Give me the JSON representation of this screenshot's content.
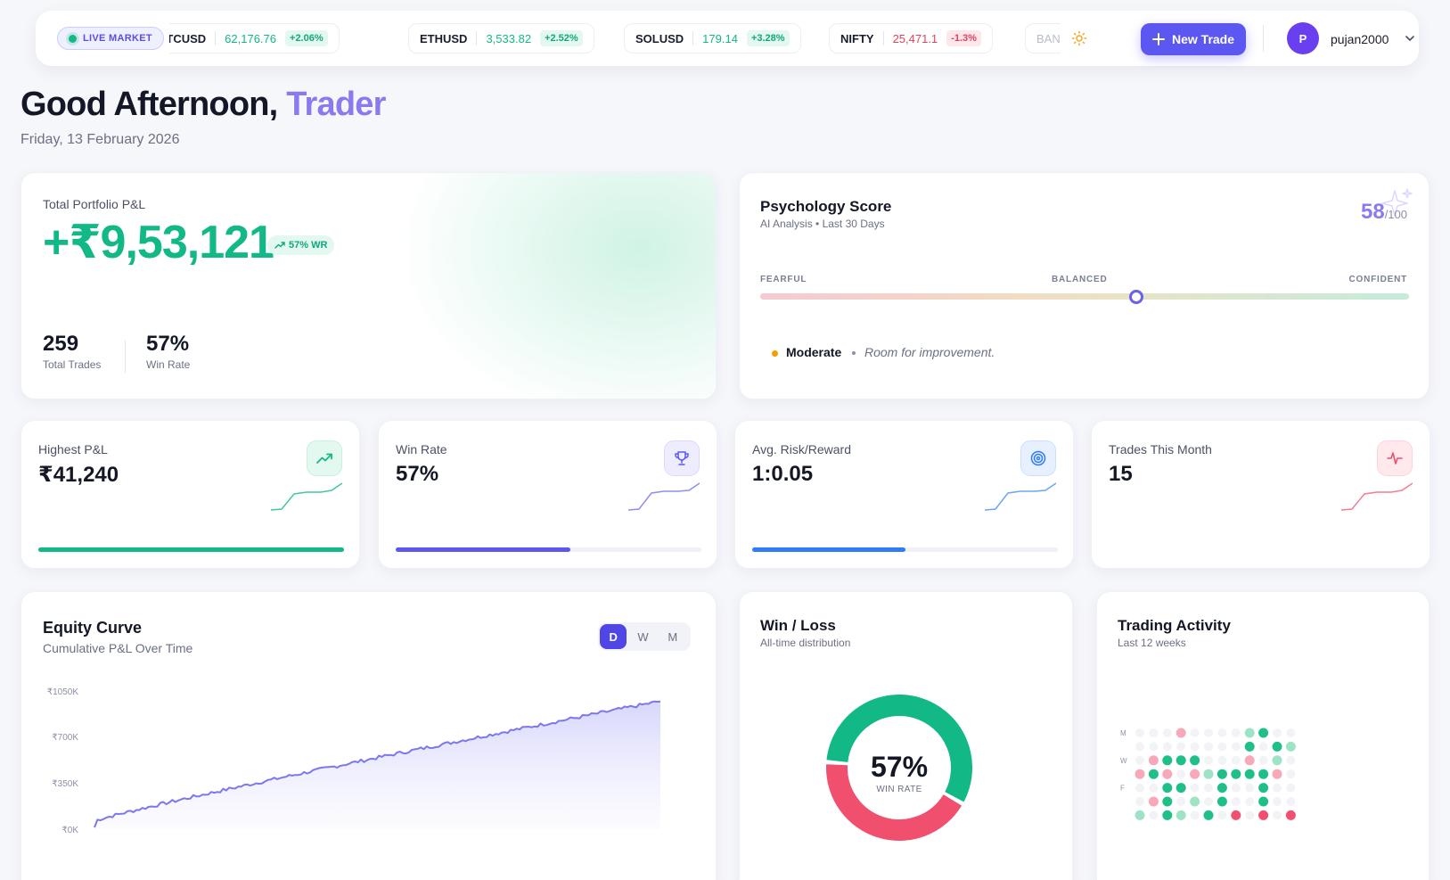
{
  "header": {
    "live_label": "LIVE MARKET",
    "tickers": [
      {
        "symbol": "BTCUSD",
        "price": "62,176.76",
        "change": "+2.06%",
        "direction": "up"
      },
      {
        "symbol": "ETHUSD",
        "price": "3,533.82",
        "change": "+2.52%",
        "direction": "up"
      },
      {
        "symbol": "SOLUSD",
        "price": "179.14",
        "change": "+3.28%",
        "direction": "up"
      },
      {
        "symbol": "NIFTY",
        "price": "25,471.1",
        "change": "-1.3%",
        "direction": "down"
      },
      {
        "symbol": "BANK",
        "price": "",
        "change": "",
        "direction": "faded"
      }
    ],
    "new_trade_label": "New Trade",
    "avatar_initial": "P",
    "username": "pujan2000",
    "icons": {
      "theme": "sun-icon",
      "add": "plus-icon",
      "menu": "chevron-down-icon"
    }
  },
  "greeting": {
    "prefix": "Good Afternoon,",
    "name": "Trader",
    "date": "Friday, 13 February 2026"
  },
  "portfolio": {
    "label": "Total Portfolio P&L",
    "value": "+₹9,53,121",
    "wr_badge": "57% WR",
    "total_trades": "259",
    "total_trades_label": "Total Trades",
    "win_rate": "57%",
    "win_rate_label": "Win Rate"
  },
  "psychology": {
    "title": "Psychology Score",
    "subtitle": "AI Analysis • Last 30 Days",
    "score": "58",
    "score_max": "/100",
    "scale_left": "FEARFUL",
    "scale_mid": "BALANCED",
    "scale_right": "CONFIDENT",
    "scale_level": 0.58,
    "mood": "Moderate",
    "note": "Room for improvement."
  },
  "stats": [
    {
      "label": "Highest P&L",
      "value": "₹41,240",
      "icon": "trending-up-icon",
      "color": "#12b886",
      "icon_bg": "#e3f8ef",
      "progress": 1.0
    },
    {
      "label": "Win Rate",
      "value": "57%",
      "icon": "trophy-icon",
      "color": "#5b57f0",
      "icon_bg": "#eeedff",
      "progress": 0.57
    },
    {
      "label": "Avg. Risk/Reward",
      "value": "1:0.05",
      "icon": "target-icon",
      "color": "#2f7cf6",
      "icon_bg": "#e6f0ff",
      "progress": 0.5
    },
    {
      "label": "Trades This Month",
      "value": "15",
      "icon": "activity-icon",
      "color": "#f0506e",
      "icon_bg": "#ffe9ec",
      "progress": 0
    }
  ],
  "equity": {
    "title": "Equity Curve",
    "subtitle": "Cumulative P&L Over Time",
    "ranges": [
      "D",
      "W",
      "M"
    ],
    "active_range": "D",
    "y_ticks": [
      "₹1050K",
      "₹700K",
      "₹350K",
      "₹0K"
    ],
    "color": "#7b78ee"
  },
  "winloss": {
    "title": "Win / Loss",
    "subtitle": "All-time distribution",
    "win_pct": 57,
    "center_value": "57%",
    "center_label": "WIN RATE",
    "win_color": "#12b886",
    "loss_color": "#f0506e"
  },
  "activity": {
    "title": "Trading Activity",
    "subtitle": "Last 12 weeks",
    "day_labels": [
      "M",
      "",
      "W",
      "",
      "F",
      "",
      ""
    ],
    "grid": [
      [
        0,
        0,
        0,
        3,
        0,
        0,
        0,
        0,
        2,
        1,
        0,
        0
      ],
      [
        0,
        0,
        0,
        0,
        0,
        0,
        0,
        0,
        1,
        0,
        1,
        2
      ],
      [
        0,
        3,
        1,
        1,
        1,
        0,
        0,
        0,
        3,
        0,
        2,
        0
      ],
      [
        3,
        1,
        3,
        0,
        3,
        2,
        1,
        1,
        1,
        1,
        3,
        0
      ],
      [
        0,
        0,
        1,
        1,
        0,
        0,
        1,
        0,
        0,
        1,
        0,
        0
      ],
      [
        0,
        3,
        1,
        0,
        2,
        0,
        1,
        0,
        0,
        1,
        0,
        0
      ],
      [
        2,
        0,
        1,
        2,
        0,
        1,
        0,
        4,
        0,
        4,
        0,
        4
      ]
    ]
  }
}
